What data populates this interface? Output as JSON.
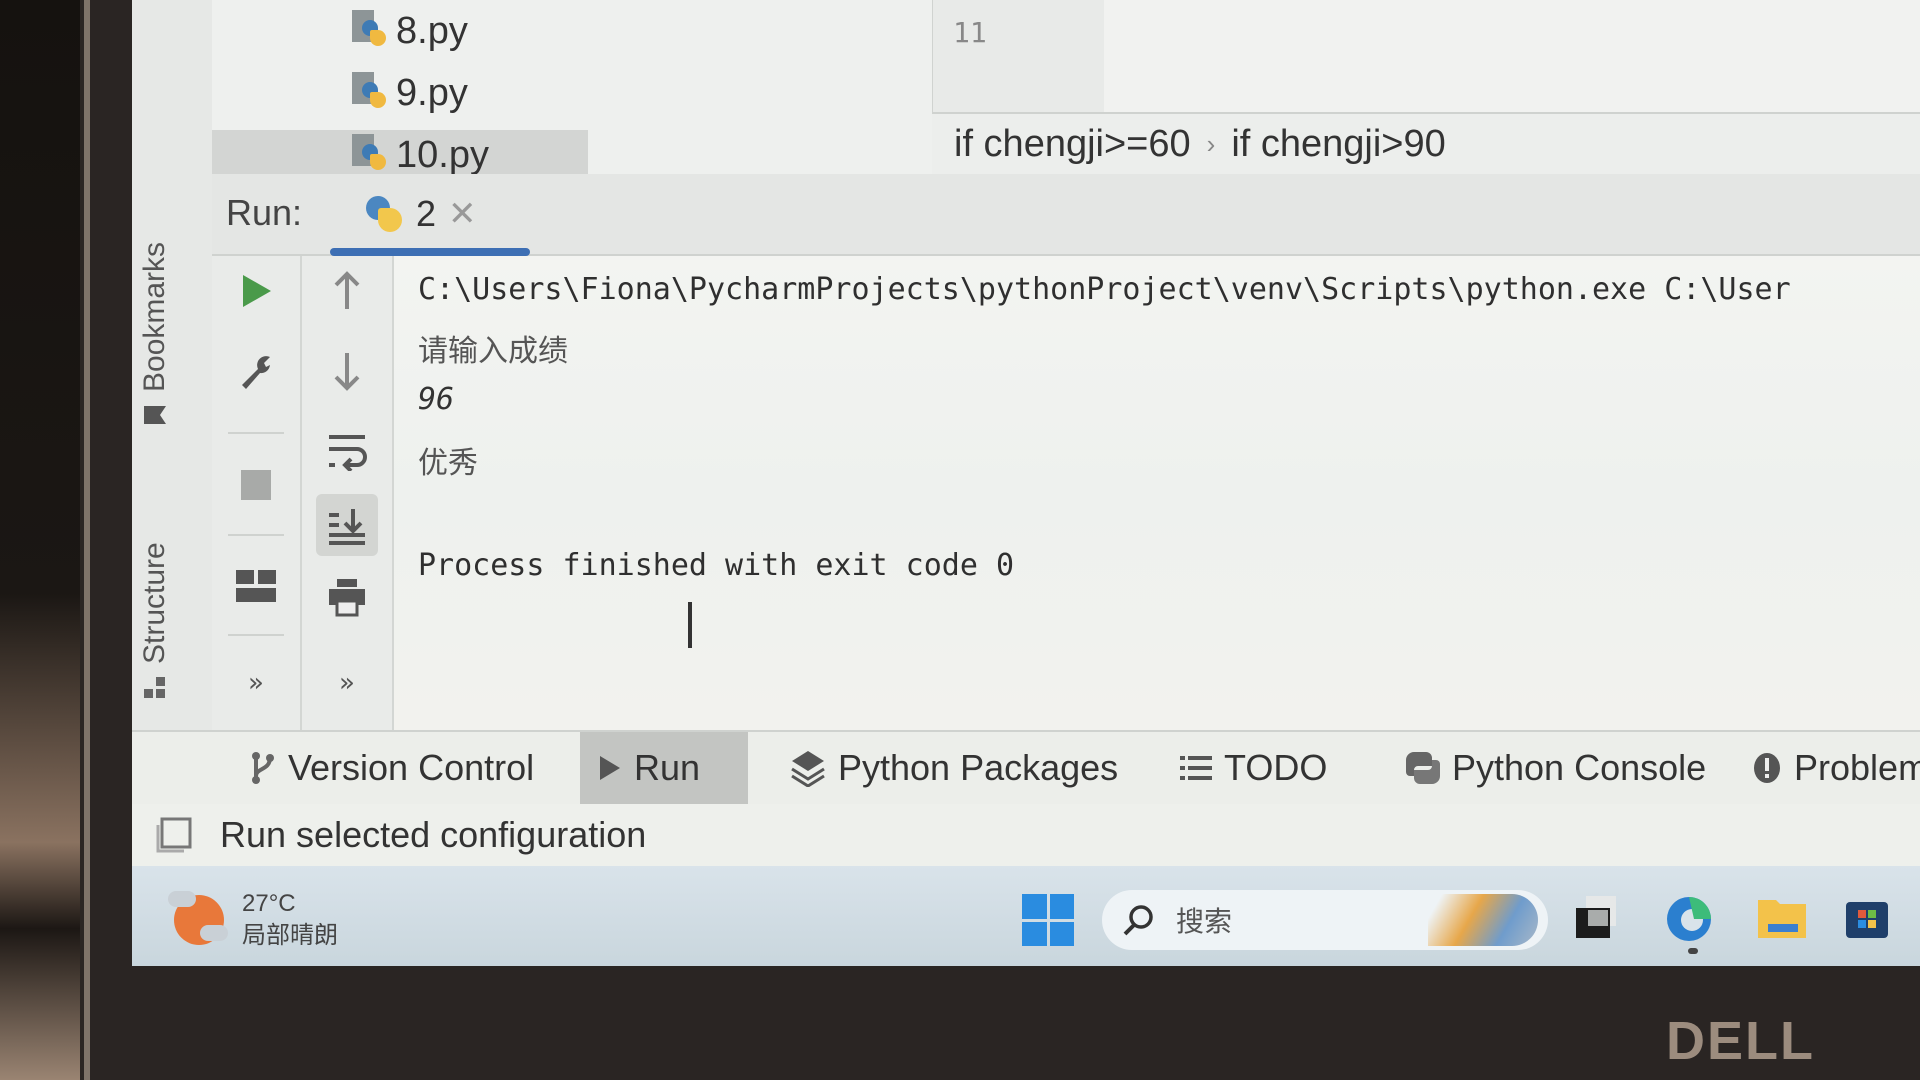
{
  "project_tree": {
    "files": [
      {
        "name": "8.py",
        "selected": false
      },
      {
        "name": "9.py",
        "selected": false
      },
      {
        "name": "10.py",
        "selected": true
      }
    ]
  },
  "editor": {
    "line_number": "11",
    "breadcrumb": [
      "if chengji>=60",
      "if chengji>90"
    ]
  },
  "side_tabs": {
    "bookmarks": "Bookmarks",
    "structure": "Structure"
  },
  "run_panel": {
    "label": "Run:",
    "tab_name": "2",
    "accent_color": "#3d6fb4",
    "run_icon_color": "#4a9a4a",
    "console_lines": [
      {
        "text": "C:\\Users\\Fiona\\PycharmProjects\\pythonProject\\venv\\Scripts\\python.exe C:\\User",
        "kind": "command"
      },
      {
        "text": "请输入成绩",
        "kind": "output"
      },
      {
        "text": "96",
        "kind": "input"
      },
      {
        "text": "优秀",
        "kind": "output"
      },
      {
        "text": "",
        "kind": "blank"
      },
      {
        "text": "Process finished with exit code 0",
        "kind": "status"
      }
    ]
  },
  "tool_window_bar": {
    "tabs": [
      {
        "label": "Version Control",
        "icon": "branch-icon",
        "active": false
      },
      {
        "label": "Run",
        "icon": "play-icon",
        "active": true
      },
      {
        "label": "Python Packages",
        "icon": "layers-icon",
        "active": false
      },
      {
        "label": "TODO",
        "icon": "list-icon",
        "active": false
      },
      {
        "label": "Python Console",
        "icon": "python-icon",
        "active": false
      },
      {
        "label": "Problems",
        "icon": "warning-icon",
        "active": false
      }
    ]
  },
  "status_bar": {
    "message": "Run selected configuration"
  },
  "taskbar": {
    "weather_temp": "27°C",
    "weather_desc": "局部晴朗",
    "search_placeholder": "搜索",
    "windows_color": "#2a8ce0"
  },
  "hardware": {
    "brand": "DELL"
  }
}
